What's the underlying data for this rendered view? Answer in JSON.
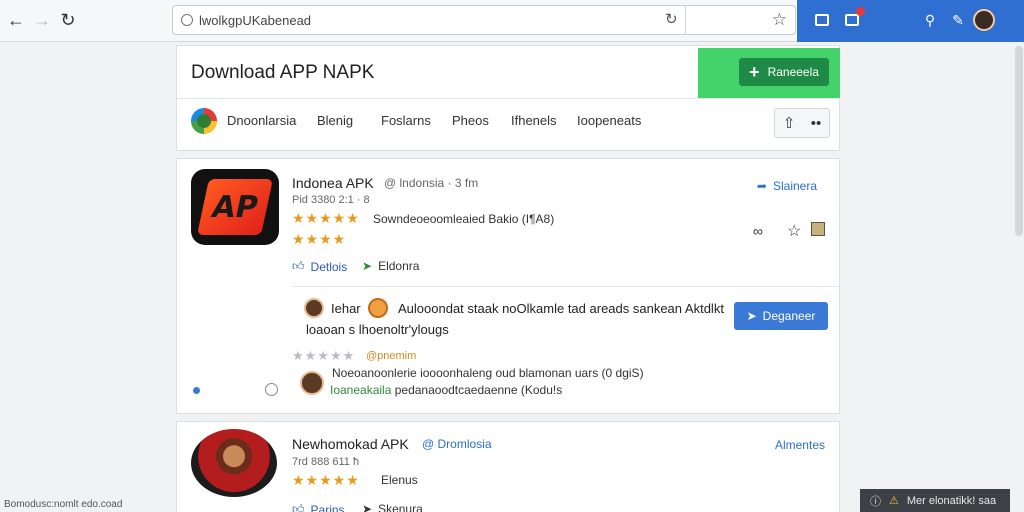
{
  "browser": {
    "url": "lwolkgpUKabenead",
    "colors": {
      "toolbar_accent": "#2f6fd1"
    }
  },
  "header": {
    "title": "Download APP NAPK",
    "download_button": "Raneeela",
    "nav": [
      "Dnoonlarsia",
      "Blenig",
      "Foslarns",
      "Pheos",
      "Ifhenels",
      "Ioopeneats"
    ],
    "accent_color": "#44d36a"
  },
  "apps": [
    {
      "title": "Indonea APK",
      "meta": "@ lndonsia · 3 fm",
      "sub": "Pid 3380 2:1 · 8",
      "rating_text": "Sowndeoeoomleaied Bakio (I¶A8)",
      "share": "Slainera",
      "details": "Detlois",
      "share2": "Eldonra",
      "comment_author": "Iehar",
      "comment_text": "Aulooondat staak noOlkamle tad areads sankean Aktdlkt",
      "comment_text2": "loaoan s lhoenoltr'ylougs",
      "download": "Deganeer",
      "handle": "@pnemim",
      "comment2": "Noeoanoonlerie ioooonhaleng oud blamonan uars (0 dgiS)",
      "comment3_green": "Ioaneakaila",
      "comment3_rest": "pedanaoodtcaedaenne (Kodu!s"
    },
    {
      "title": "Newhomokad APK",
      "meta": "@ Dromlosia",
      "sub": "7rd 888 611 ħ",
      "share2": "Elenus",
      "learn": "Almentes",
      "details": "Parins",
      "share3": "Skenura"
    }
  ],
  "status": {
    "left": "Bomodusc:nomlt edo.coad",
    "right": "Mer elonatikk! saa"
  }
}
